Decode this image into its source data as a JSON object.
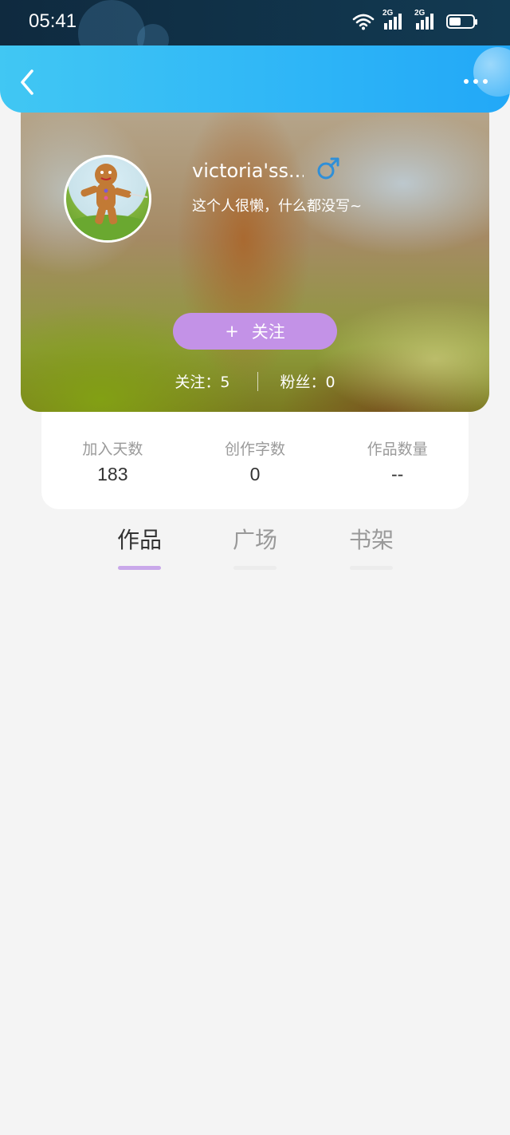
{
  "status_bar": {
    "time": "05:41",
    "signal_1_label": "2G",
    "signal_2_label": "2G",
    "icons": [
      "wifi-icon",
      "signal-icon",
      "signal-icon",
      "battery-icon"
    ]
  },
  "header": {
    "back_icon": "chevron-left-icon",
    "more_icon": "more-horizontal-icon"
  },
  "profile": {
    "name": "victoria'ss...",
    "gender_icon": "male-icon",
    "bio": "这个人很懒，什么都没写~",
    "follow_button": {
      "icon": "+",
      "label": "关注"
    },
    "following": "关注：5",
    "followers": "粉丝：0"
  },
  "stats": [
    {
      "label": "加入天数",
      "value": "183"
    },
    {
      "label": "创作字数",
      "value": "0"
    },
    {
      "label": "作品数量",
      "value": "--"
    }
  ],
  "tabs": [
    {
      "label": "作品",
      "active": true
    },
    {
      "label": "广场",
      "active": false
    },
    {
      "label": "书架",
      "active": false
    }
  ],
  "colors": {
    "header_start": "#41c7f3",
    "header_end": "#22a8f7",
    "follow_button": "#c392e7",
    "tab_underline_active": "#c9a8ea",
    "gender_icon": "#2f8fd8"
  }
}
